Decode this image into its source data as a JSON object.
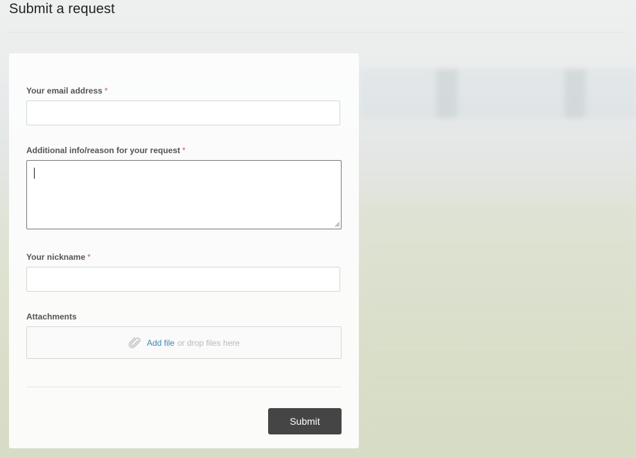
{
  "page": {
    "title": "Submit a request"
  },
  "form": {
    "email": {
      "label": "Your email address",
      "required_mark": "*",
      "value": "",
      "placeholder": ""
    },
    "additional_info": {
      "label": "Additional info/reason for your request",
      "required_mark": "*",
      "value": "",
      "placeholder": ""
    },
    "nickname": {
      "label": "Your nickname",
      "required_mark": "*",
      "value": "",
      "placeholder": ""
    },
    "attachments": {
      "label": "Attachments",
      "add_file_label": "Add file",
      "drop_hint": "or drop files here",
      "icon": "paperclip-icon"
    },
    "submit_label": "Submit"
  },
  "colors": {
    "required": "#d9534f",
    "link": "#3a87b5",
    "submit_bg": "#454545",
    "submit_text": "#ffffff"
  }
}
